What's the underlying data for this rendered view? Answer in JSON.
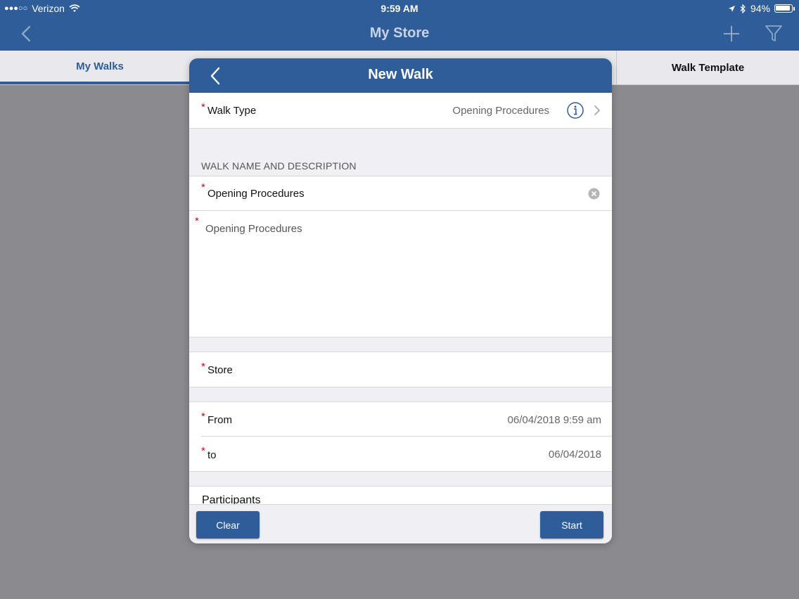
{
  "status_bar": {
    "signal": "●●●○○",
    "carrier": "Verizon",
    "time": "9:59 AM",
    "battery_percent": "94%"
  },
  "nav": {
    "title": "My Store"
  },
  "tabs": [
    {
      "label": "My Walks",
      "active": true
    },
    {
      "label": "Walk Template",
      "active": false
    }
  ],
  "modal": {
    "title": "New Walk",
    "walk_type": {
      "label": "Walk Type",
      "value": "Opening Procedures"
    },
    "section_title": "WALK NAME AND DESCRIPTION",
    "walk_name": {
      "value": "Opening Procedures"
    },
    "description": {
      "value": "Opening Procedures"
    },
    "store": {
      "label": "Store"
    },
    "from": {
      "label": "From",
      "value": "06/04/2018 9:59 am"
    },
    "to": {
      "label": "to",
      "value": "06/04/2018"
    },
    "participants": {
      "label": "Participants"
    },
    "required_marker": "*",
    "buttons": {
      "clear": "Clear",
      "start": "Start"
    }
  },
  "colors": {
    "accent": "#2e5d9a",
    "required": "#d0021b",
    "backdrop": "#8a8a8f"
  }
}
